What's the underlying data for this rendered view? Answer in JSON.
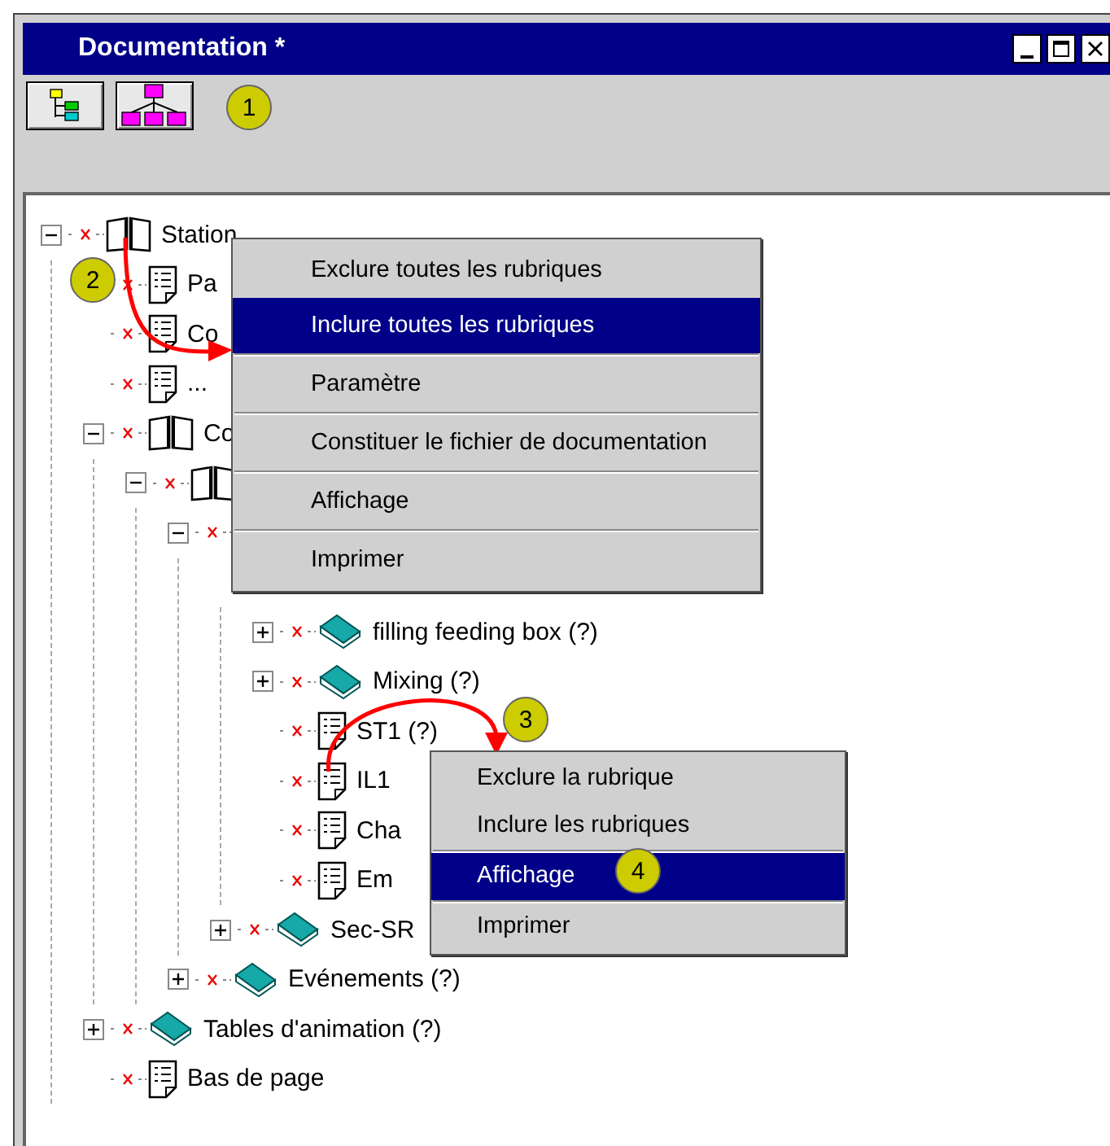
{
  "window": {
    "title": "Documentation *"
  },
  "toolbar": [
    {
      "kind": "tree-view"
    },
    {
      "kind": "hierarchy-view"
    }
  ],
  "tree": [
    {
      "label": "Station",
      "kind": "open-book",
      "expanded": true,
      "children": [
        {
          "label": "Pa",
          "kind": "page"
        },
        {
          "label": "Co",
          "kind": "page"
        },
        {
          "label": "...",
          "kind": "page"
        },
        {
          "label": "Co",
          "kind": "open-book",
          "expanded": true,
          "children": [
            {
              "kind": "open-book",
              "expanded": true,
              "children": [
                {
                  "expanded": true,
                  "children": [
                    {
                      "kind": "hidden",
                      "children": [
                        {
                          "label": "filling feeding box (?)",
                          "kind": "closed-book",
                          "expanded": false
                        },
                        {
                          "label": "Mixing (?)",
                          "kind": "closed-book",
                          "expanded": false
                        },
                        {
                          "label": "ST1 (?)",
                          "kind": "page"
                        },
                        {
                          "label": "IL1",
                          "kind": "page"
                        },
                        {
                          "label": "Cha",
                          "kind": "page"
                        },
                        {
                          "label": "Em",
                          "kind": "page"
                        }
                      ]
                    },
                    {
                      "label": "Sec-SR",
                      "kind": "closed-book",
                      "expanded": false
                    }
                  ]
                },
                {
                  "label": "Evénements (?)",
                  "kind": "closed-book",
                  "expanded": false
                }
              ]
            }
          ]
        },
        {
          "label": "Tables d'animation (?)",
          "kind": "closed-book",
          "expanded": false
        },
        {
          "label": "Bas de page",
          "kind": "page"
        }
      ]
    }
  ],
  "context_menus": [
    {
      "items": [
        {
          "label": "Exclure toutes les rubriques",
          "selected": false,
          "separator": false
        },
        {
          "label": "Inclure toutes les rubriques",
          "selected": true,
          "separator": false
        },
        {
          "label": "Paramètre",
          "selected": false,
          "separator": true
        },
        {
          "label": "Constituer le fichier de documentation",
          "selected": false,
          "separator": true
        },
        {
          "label": "Affichage",
          "selected": false,
          "separator": true
        },
        {
          "label": "Imprimer",
          "selected": false,
          "separator": true
        }
      ]
    },
    {
      "items": [
        {
          "label": "Exclure la rubrique",
          "selected": false,
          "separator": false
        },
        {
          "label": "Inclure les rubriques",
          "selected": false,
          "separator": false
        },
        {
          "label": "Affichage",
          "selected": true,
          "separator": true
        },
        {
          "label": "Imprimer",
          "selected": false,
          "separator": true
        }
      ]
    }
  ],
  "callouts": [
    "1",
    "2",
    "3",
    "4"
  ]
}
